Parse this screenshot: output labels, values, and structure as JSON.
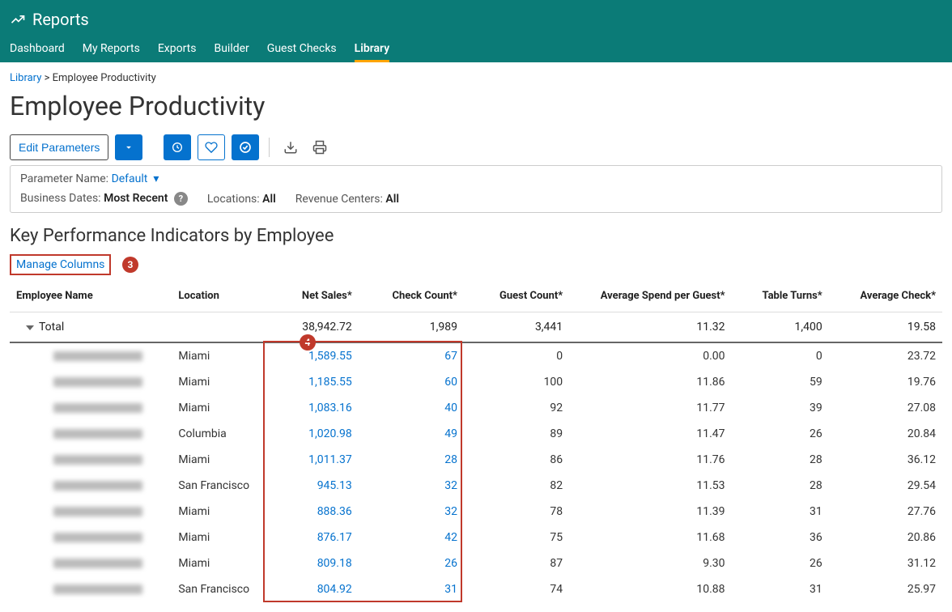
{
  "header": {
    "title": "Reports",
    "tabs": [
      "Dashboard",
      "My Reports",
      "Exports",
      "Builder",
      "Guest Checks",
      "Library"
    ],
    "active_tab": "Library"
  },
  "breadcrumb": {
    "root": "Library",
    "current": "Employee Productivity"
  },
  "page_title": "Employee Productivity",
  "toolbar": {
    "edit_parameters": "Edit Parameters"
  },
  "parameters": {
    "name_label": "Parameter Name:",
    "name_value": "Default",
    "dates_label": "Business Dates:",
    "dates_value": "Most Recent",
    "locations_label": "Locations:",
    "locations_value": "All",
    "revenue_label": "Revenue Centers:",
    "revenue_value": "All"
  },
  "section_title": "Key Performance Indicators by Employee",
  "manage_columns": "Manage Columns",
  "callouts": {
    "three": "3",
    "four": "4"
  },
  "table": {
    "headers": {
      "employee": "Employee Name",
      "location": "Location",
      "net_sales": "Net Sales*",
      "check_count": "Check Count*",
      "guest_count": "Guest Count*",
      "avg_spend": "Average Spend per Guest*",
      "table_turns": "Table Turns*",
      "avg_check": "Average Check*"
    },
    "total": {
      "label": "Total",
      "net_sales": "38,942.72",
      "check_count": "1,989",
      "guest_count": "3,441",
      "avg_spend": "11.32",
      "table_turns": "1,400",
      "avg_check": "19.58"
    },
    "rows": [
      {
        "location": "Miami",
        "net_sales": "1,589.55",
        "check_count": "67",
        "guest_count": "0",
        "avg_spend": "0.00",
        "table_turns": "0",
        "avg_check": "23.72"
      },
      {
        "location": "Miami",
        "net_sales": "1,185.55",
        "check_count": "60",
        "guest_count": "100",
        "avg_spend": "11.86",
        "table_turns": "59",
        "avg_check": "19.76"
      },
      {
        "location": "Miami",
        "net_sales": "1,083.16",
        "check_count": "40",
        "guest_count": "92",
        "avg_spend": "11.77",
        "table_turns": "39",
        "avg_check": "27.08"
      },
      {
        "location": "Columbia",
        "net_sales": "1,020.98",
        "check_count": "49",
        "guest_count": "89",
        "avg_spend": "11.47",
        "table_turns": "26",
        "avg_check": "20.84"
      },
      {
        "location": "Miami",
        "net_sales": "1,011.37",
        "check_count": "28",
        "guest_count": "86",
        "avg_spend": "11.76",
        "table_turns": "28",
        "avg_check": "36.12"
      },
      {
        "location": "San Francisco",
        "net_sales": "945.13",
        "check_count": "32",
        "guest_count": "82",
        "avg_spend": "11.53",
        "table_turns": "28",
        "avg_check": "29.54"
      },
      {
        "location": "Miami",
        "net_sales": "888.36",
        "check_count": "32",
        "guest_count": "78",
        "avg_spend": "11.39",
        "table_turns": "31",
        "avg_check": "27.76"
      },
      {
        "location": "Miami",
        "net_sales": "876.17",
        "check_count": "42",
        "guest_count": "75",
        "avg_spend": "11.68",
        "table_turns": "36",
        "avg_check": "20.86"
      },
      {
        "location": "Miami",
        "net_sales": "809.18",
        "check_count": "26",
        "guest_count": "87",
        "avg_spend": "9.30",
        "table_turns": "26",
        "avg_check": "31.12"
      },
      {
        "location": "San Francisco",
        "net_sales": "804.92",
        "check_count": "31",
        "guest_count": "74",
        "avg_spend": "10.88",
        "table_turns": "31",
        "avg_check": "25.97"
      }
    ]
  }
}
